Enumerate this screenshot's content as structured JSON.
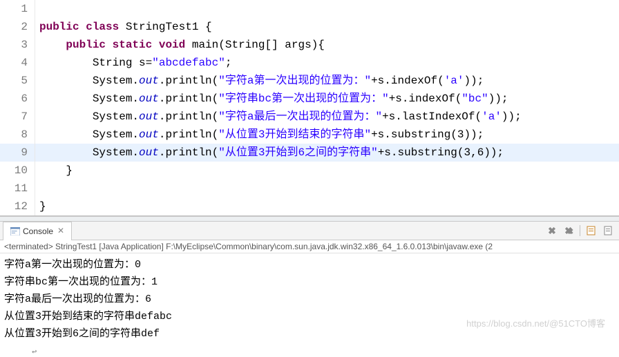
{
  "editor": {
    "lines": [
      {
        "n": 1,
        "indent": "",
        "tokens": []
      },
      {
        "n": 2,
        "indent": "",
        "tokens": [
          {
            "t": "public ",
            "c": "kw"
          },
          {
            "t": "class ",
            "c": "kw"
          },
          {
            "t": "StringTest1 {",
            "c": "cls"
          }
        ]
      },
      {
        "n": 3,
        "indent": "    ",
        "tokens": [
          {
            "t": "public ",
            "c": "kw"
          },
          {
            "t": "static ",
            "c": "kw"
          },
          {
            "t": "void ",
            "c": "kw"
          },
          {
            "t": "main(String[] args){",
            "c": "cls"
          }
        ]
      },
      {
        "n": 4,
        "indent": "        ",
        "tokens": [
          {
            "t": "String s=",
            "c": "cls"
          },
          {
            "t": "\"abcdefabc\"",
            "c": "str"
          },
          {
            "t": ";",
            "c": "cls"
          }
        ]
      },
      {
        "n": 5,
        "indent": "        ",
        "tokens": [
          {
            "t": "System.",
            "c": "cls"
          },
          {
            "t": "out",
            "c": "fld"
          },
          {
            "t": ".println(",
            "c": "cls"
          },
          {
            "t": "\"字符a第一次出现的位置为：\"",
            "c": "str"
          },
          {
            "t": "+s.indexOf(",
            "c": "cls"
          },
          {
            "t": "'a'",
            "c": "str"
          },
          {
            "t": "));",
            "c": "cls"
          }
        ]
      },
      {
        "n": 6,
        "indent": "        ",
        "tokens": [
          {
            "t": "System.",
            "c": "cls"
          },
          {
            "t": "out",
            "c": "fld"
          },
          {
            "t": ".println(",
            "c": "cls"
          },
          {
            "t": "\"字符串bc第一次出现的位置为：\"",
            "c": "str"
          },
          {
            "t": "+s.indexOf(",
            "c": "cls"
          },
          {
            "t": "\"bc\"",
            "c": "str"
          },
          {
            "t": "));",
            "c": "cls"
          }
        ]
      },
      {
        "n": 7,
        "indent": "        ",
        "tokens": [
          {
            "t": "System.",
            "c": "cls"
          },
          {
            "t": "out",
            "c": "fld"
          },
          {
            "t": ".println(",
            "c": "cls"
          },
          {
            "t": "\"字符a最后一次出现的位置为：\"",
            "c": "str"
          },
          {
            "t": "+s.lastIndexOf(",
            "c": "cls"
          },
          {
            "t": "'a'",
            "c": "str"
          },
          {
            "t": "));",
            "c": "cls"
          }
        ]
      },
      {
        "n": 8,
        "indent": "        ",
        "tokens": [
          {
            "t": "System.",
            "c": "cls"
          },
          {
            "t": "out",
            "c": "fld"
          },
          {
            "t": ".println(",
            "c": "cls"
          },
          {
            "t": "\"从位置3开始到结束的字符串\"",
            "c": "str"
          },
          {
            "t": "+s.substring(3));",
            "c": "cls"
          }
        ]
      },
      {
        "n": 9,
        "indent": "        ",
        "tokens": [
          {
            "t": "System.",
            "c": "cls"
          },
          {
            "t": "out",
            "c": "fld"
          },
          {
            "t": ".println(",
            "c": "cls"
          },
          {
            "t": "\"从位置3开始到6之间的字符串\"",
            "c": "str"
          },
          {
            "t": "+s.substring(3,6));",
            "c": "cls"
          }
        ],
        "current": true
      },
      {
        "n": 10,
        "indent": "    ",
        "tokens": [
          {
            "t": "}",
            "c": "cls"
          }
        ]
      },
      {
        "n": 11,
        "indent": "",
        "tokens": []
      },
      {
        "n": 12,
        "indent": "",
        "tokens": [
          {
            "t": "}",
            "c": "cls"
          }
        ]
      }
    ]
  },
  "console": {
    "tab_title": "Console",
    "terminated": "<terminated> StringTest1 [Java Application] F:\\MyEclipse\\Common\\binary\\com.sun.java.jdk.win32.x86_64_1.6.0.013\\bin\\javaw.exe (2",
    "output": [
      "字符a第一次出现的位置为：0",
      "字符串bc第一次出现的位置为：1",
      "字符a最后一次出现的位置为：6",
      "从位置3开始到结束的字符串defabc",
      "从位置3开始到6之间的字符串def"
    ]
  },
  "watermark": "https://blog.csdn.net/@51CTO博客"
}
